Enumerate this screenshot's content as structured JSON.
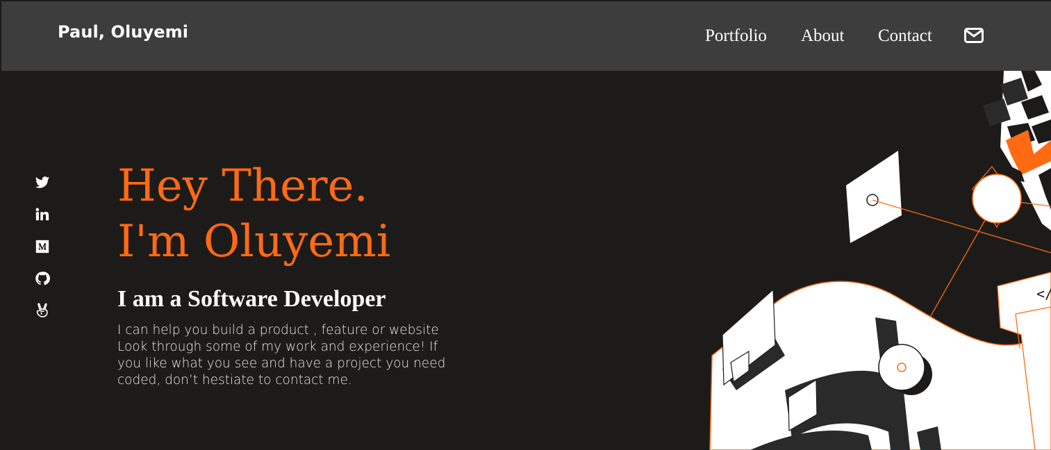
{
  "brand": {
    "name": "Paul, Oluyemi"
  },
  "nav": {
    "items": [
      {
        "label": "Portfolio"
      },
      {
        "label": "About"
      },
      {
        "label": "Contact"
      }
    ],
    "mail_icon": "envelope-icon"
  },
  "social": {
    "icons": [
      "twitter-icon",
      "linkedin-icon",
      "medium-icon",
      "github-icon",
      "angellist-icon"
    ]
  },
  "hero": {
    "greeting_line1": "Hey There.",
    "greeting_line2": "I'm Oluyemi",
    "role": "I am a Software Developer",
    "description": "I can help you build a product , feature or website Look through some of my work and experience! If you like what you see and have a project you need coded, don’t hestiate to contact me."
  },
  "colors": {
    "accent": "#ff6a13",
    "navbar_bg": "#3d3d3d",
    "page_bg": "#1c1b1a",
    "text": "#ffffff"
  }
}
